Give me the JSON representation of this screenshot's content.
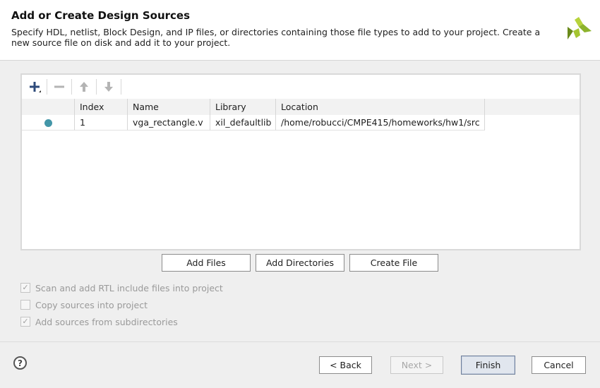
{
  "header": {
    "title": "Add or Create Design Sources",
    "description": "Specify HDL, netlist, Block Design, and IP files, or directories containing those file types to add to your project. Create a new source file on disk and add it to your project."
  },
  "toolbar": {
    "icons": [
      "plus-icon",
      "minus-icon",
      "arrow-up-icon",
      "arrow-down-icon"
    ]
  },
  "table": {
    "columns": [
      "",
      "Index",
      "Name",
      "Library",
      "Location"
    ],
    "rows": [
      {
        "index": "1",
        "name": "vga_rectangle.v",
        "library": "xil_defaultlib",
        "location": "/home/robucci/CMPE415/homeworks/hw1/src"
      }
    ]
  },
  "actions": {
    "add_files": "Add Files",
    "add_directories": "Add Directories",
    "create_file": "Create File"
  },
  "options": {
    "scan_rtl": {
      "label": "Scan and add RTL include files into project",
      "checked": true
    },
    "copy_sources": {
      "label": "Copy sources into project",
      "checked": false
    },
    "add_subdirs": {
      "label": "Add sources from subdirectories",
      "checked": true
    }
  },
  "footer": {
    "help": "?",
    "back": "< Back",
    "next": "Next >",
    "finish": "Finish",
    "cancel": "Cancel"
  },
  "colors": {
    "status_dot": "#4396a8",
    "logo_green": "#8db32d",
    "logo_dark": "#6a8a1a"
  }
}
